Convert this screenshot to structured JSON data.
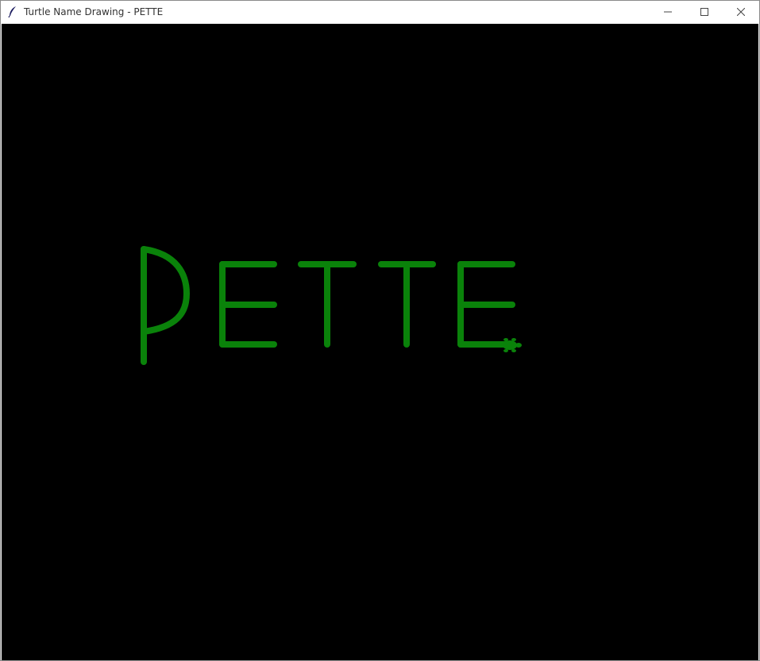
{
  "window": {
    "title": "Turtle Name Drawing - PETTE",
    "app_icon": "feather-icon",
    "controls": [
      "minimize-icon",
      "maximize-icon",
      "close-icon"
    ]
  },
  "canvas": {
    "background": "#000000",
    "pen_color": "#0a820a",
    "drawn_name": "PETTE",
    "turtle_color": "#0a820a"
  }
}
